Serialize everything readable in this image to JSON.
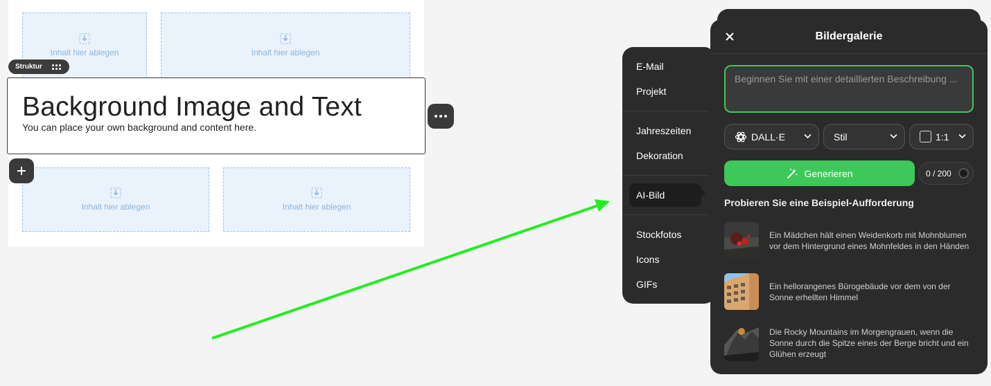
{
  "canvas": {
    "drop_label": "Inhalt hier ablegen",
    "structure_chip": "Struktur",
    "block": {
      "title": "Background Image and Text",
      "subtitle": "You can place your own background and content here."
    }
  },
  "menu": {
    "items": [
      {
        "label": "E-Mail"
      },
      {
        "label": "Projekt"
      },
      {
        "label": "Jahreszeiten"
      },
      {
        "label": "Dekoration"
      },
      {
        "label": "AI-Bild",
        "active": true
      },
      {
        "label": "Stockfotos"
      },
      {
        "label": "Icons"
      },
      {
        "label": "GIFs"
      }
    ]
  },
  "gallery": {
    "title": "Bildergalerie",
    "prompt_placeholder": "Beginnen Sie mit einer detaillierten Beschreibung ...",
    "model_select": "DALL·E",
    "style_select": "Stil",
    "ratio_select": "1:1",
    "generate_label": "Generieren",
    "counter": "0 / 200",
    "examples_title": "Probieren Sie eine Beispiel-Aufforderung",
    "examples": [
      {
        "text": "Ein Mädchen hält einen Weidenkorb mit Mohnblumen vor dem Hintergrund eines Mohnfeldes in den Händen"
      },
      {
        "text": "Ein hellorangenes Bürogebäude vor dem von der Sonne erhellten Himmel"
      },
      {
        "text": "Die Rocky Mountains im Morgengrauen, wenn die Sonne durch die Spitze eines der Berge bricht und ein Glühen erzeugt"
      }
    ]
  },
  "colors": {
    "accent_green": "#3ec85a",
    "panel_bg": "#2b2b2b",
    "drop_bg": "#eaf2fc",
    "arrow_green": "#22ee22"
  }
}
